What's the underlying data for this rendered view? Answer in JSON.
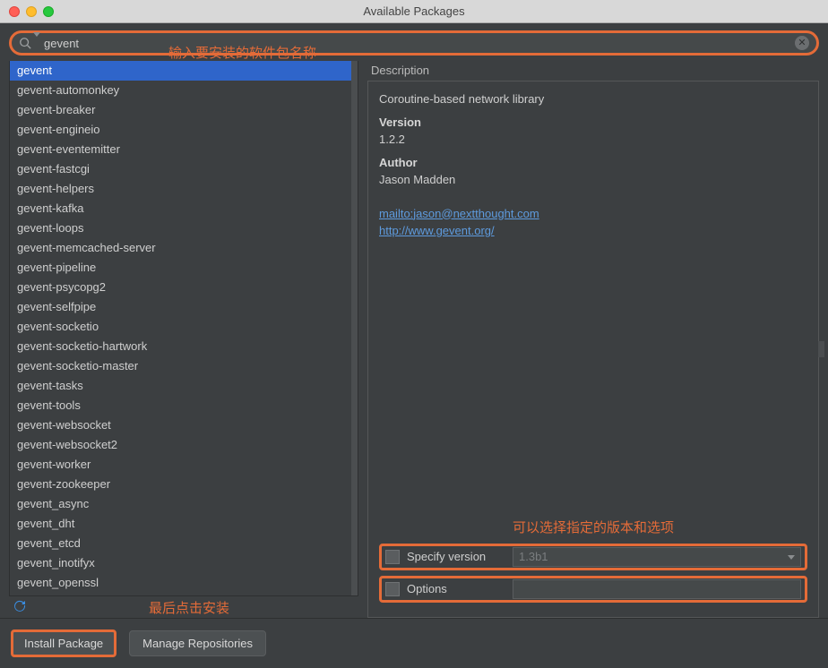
{
  "window": {
    "title": "Available Packages"
  },
  "search": {
    "value": "gevent"
  },
  "annotations": {
    "search": "输入要安装的软件包名称",
    "version": "可以选择指定的版本和选项",
    "install": "最后点击安装"
  },
  "packages": [
    "gevent",
    "gevent-automonkey",
    "gevent-breaker",
    "gevent-engineio",
    "gevent-eventemitter",
    "gevent-fastcgi",
    "gevent-helpers",
    "gevent-kafka",
    "gevent-loops",
    "gevent-memcached-server",
    "gevent-pipeline",
    "gevent-psycopg2",
    "gevent-selfpipe",
    "gevent-socketio",
    "gevent-socketio-hartwork",
    "gevent-socketio-master",
    "gevent-tasks",
    "gevent-tools",
    "gevent-websocket",
    "gevent-websocket2",
    "gevent-worker",
    "gevent-zookeeper",
    "gevent_async",
    "gevent_dht",
    "gevent_etcd",
    "gevent_inotifyx",
    "gevent_openssl"
  ],
  "selected_index": 0,
  "description": {
    "header": "Description",
    "summary": "Coroutine-based network library",
    "version_label": "Version",
    "version": "1.2.2",
    "author_label": "Author",
    "author": "Jason Madden",
    "links": [
      {
        "text": "mailto:jason@nextthought.com",
        "href": "#"
      },
      {
        "text": "http://www.gevent.org/",
        "href": "#"
      }
    ]
  },
  "options": {
    "specify_version_label": "Specify version",
    "specify_version_value": "1.3b1",
    "options_label": "Options",
    "options_value": ""
  },
  "buttons": {
    "install": "Install Package",
    "manage": "Manage Repositories"
  }
}
